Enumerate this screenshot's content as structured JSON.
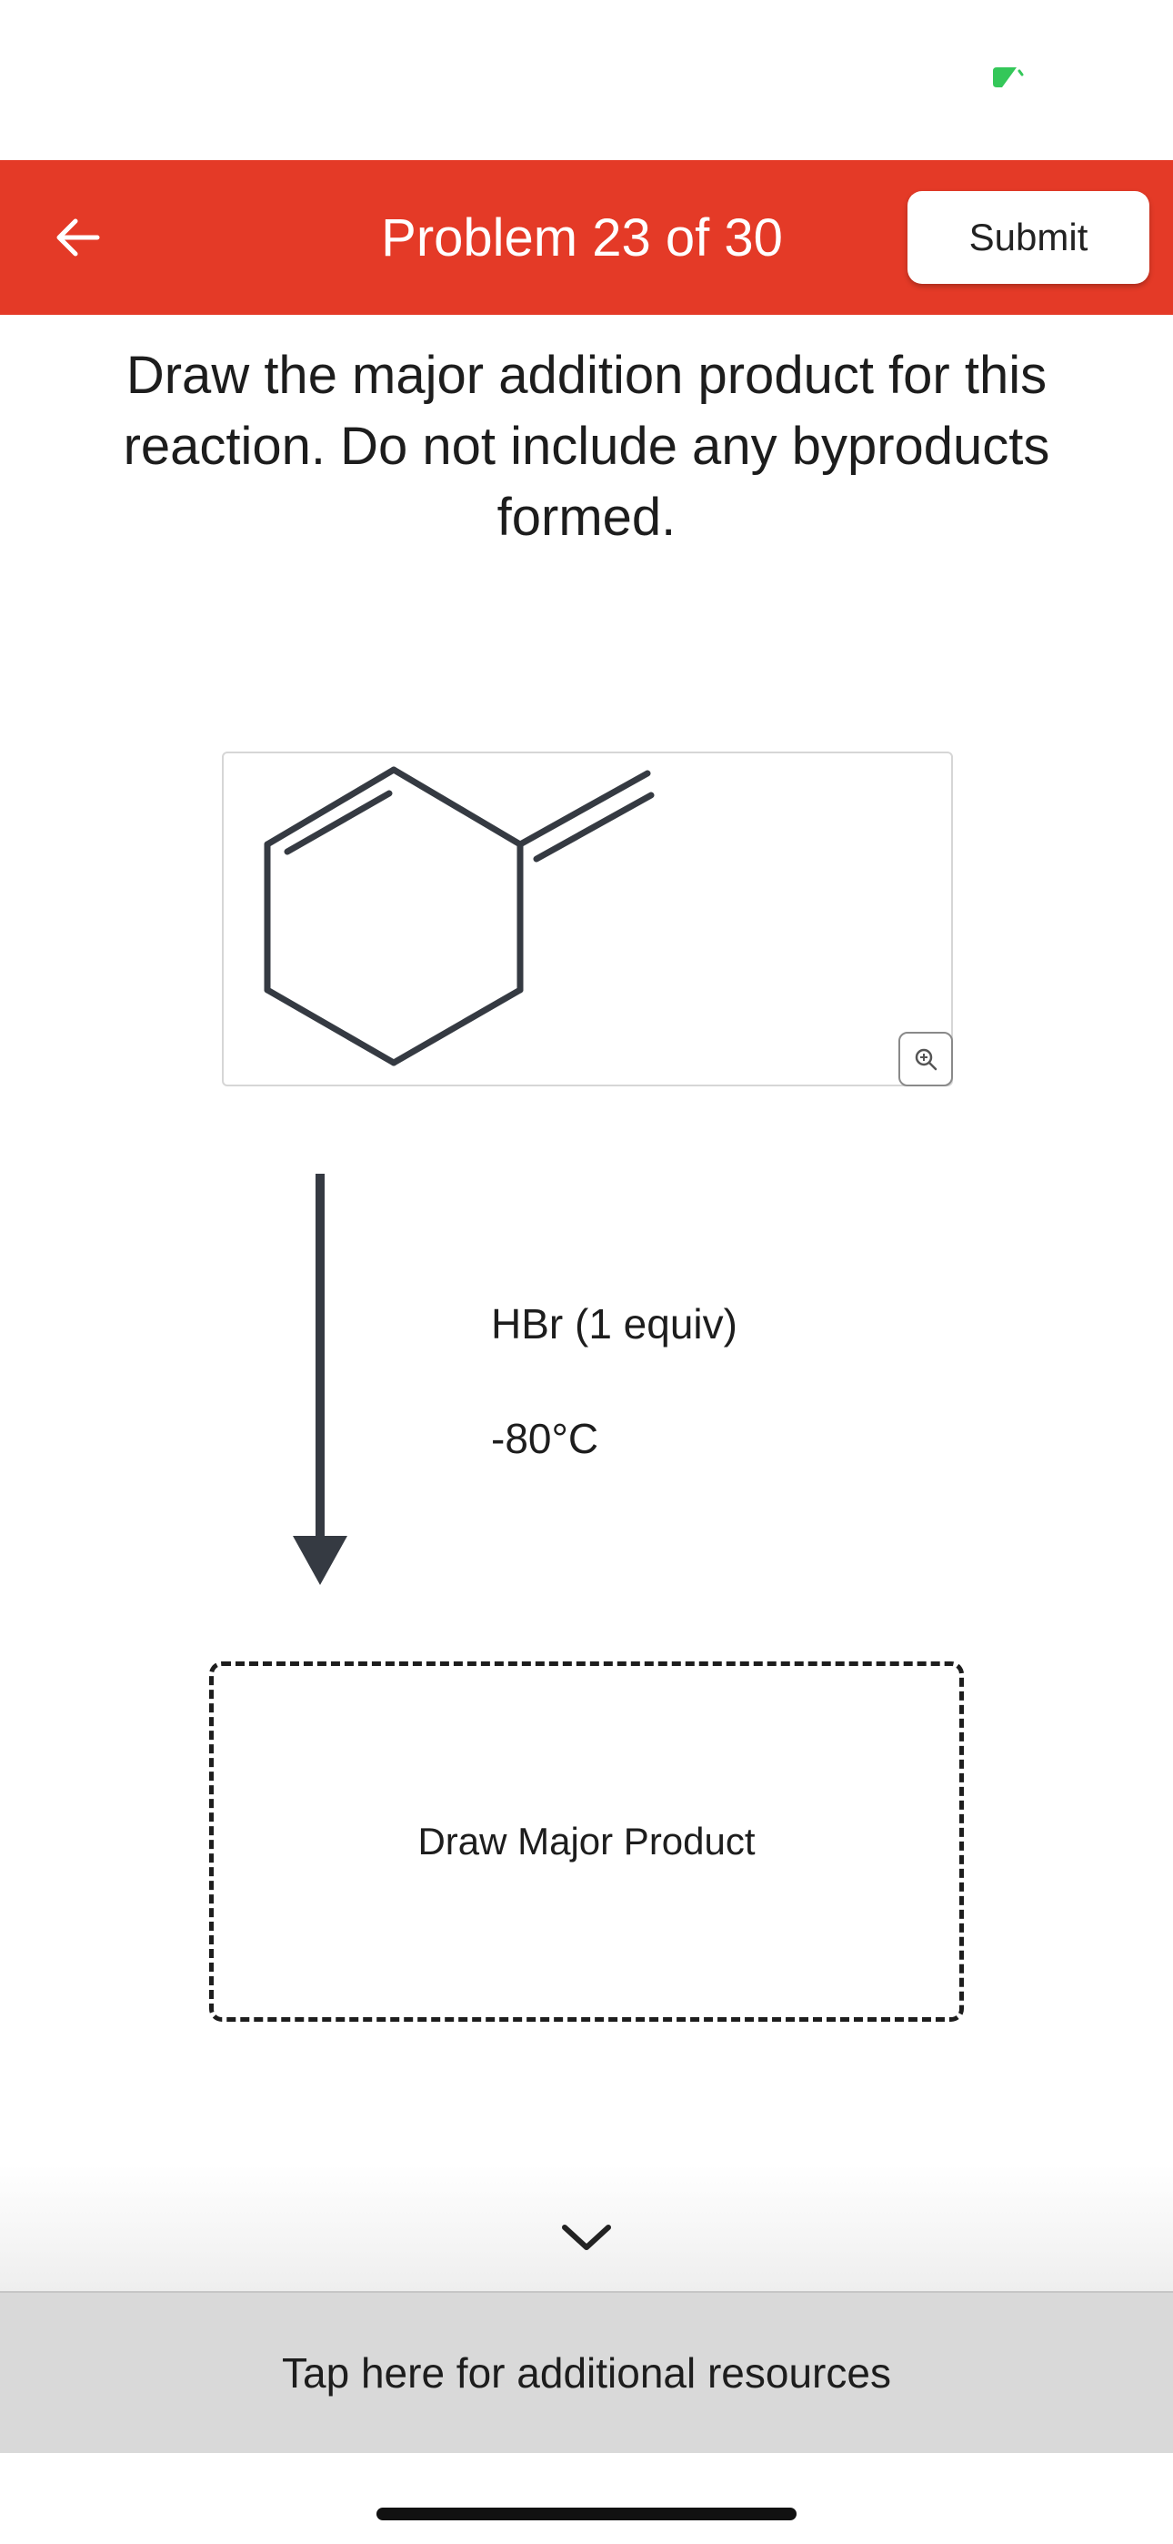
{
  "status_bar": {
    "indicator_color": "#34c759"
  },
  "header": {
    "title": "Problem 23 of 30",
    "submit_label": "Submit",
    "background_color": "#e43a27",
    "back_icon": "arrow-left-icon"
  },
  "question": {
    "text": "Draw the major addition product for this reaction. Do not include any byproducts formed."
  },
  "reactant": {
    "description_icon": "methylenecyclohexene-structure",
    "zoom_icon": "zoom-in-icon"
  },
  "reaction": {
    "arrow_icon": "down-arrow-icon",
    "reagent": "HBr (1 equiv)",
    "condition": "-80°C"
  },
  "product": {
    "placeholder": "Draw Major Product"
  },
  "footer": {
    "chevron_icon": "chevron-down-icon",
    "resources_label": "Tap here for additional resources"
  }
}
